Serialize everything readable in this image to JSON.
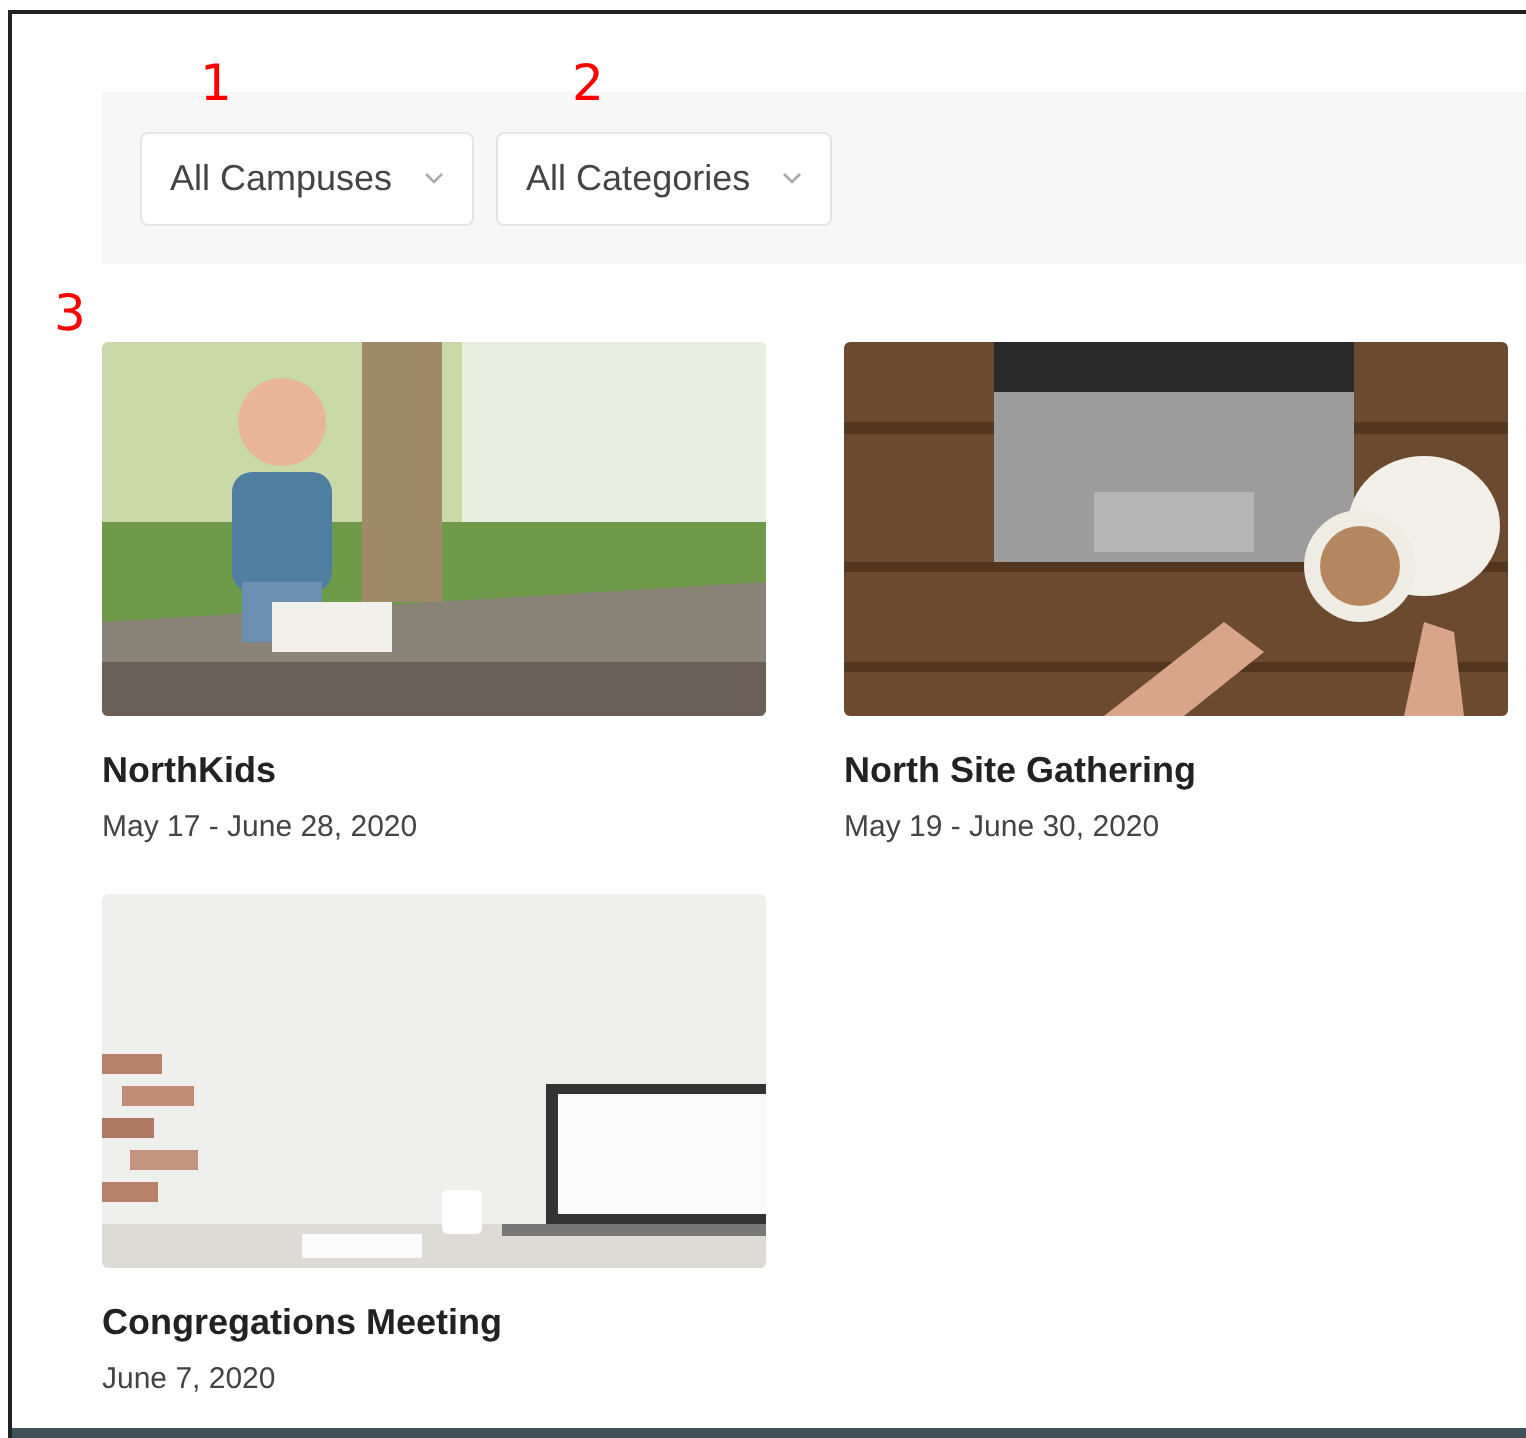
{
  "annotations": [
    {
      "label": "1"
    },
    {
      "label": "2"
    },
    {
      "label": "3"
    }
  ],
  "filters": [
    {
      "label": "All Campuses"
    },
    {
      "label": "All Categories"
    }
  ],
  "events": [
    {
      "title": "NorthKids",
      "dates": "May 17 - June 28, 2020"
    },
    {
      "title": "North Site Gathering",
      "dates": "May 19 - June 30, 2020"
    },
    {
      "title": "Congregations Meeting",
      "dates": "June 7, 2020"
    }
  ]
}
